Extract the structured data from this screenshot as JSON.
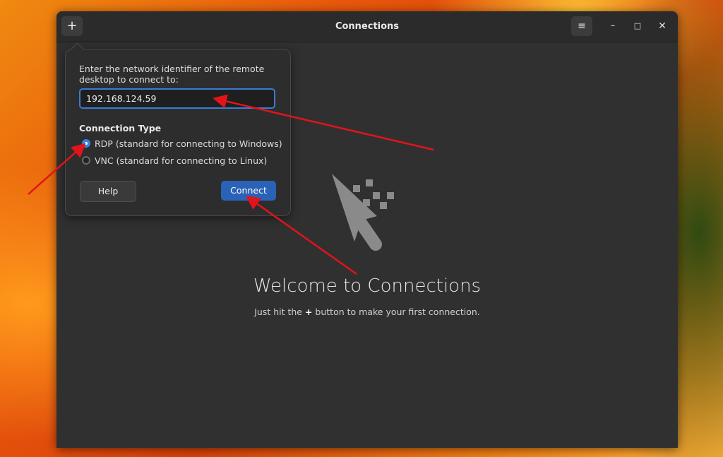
{
  "window": {
    "title": "Connections",
    "add_icon": "+",
    "menu_icon": "≡",
    "minimize_icon": "–",
    "maximize_icon": "□",
    "close_icon": "✕"
  },
  "popover": {
    "prompt": "Enter the network identifier of the remote desktop to connect to:",
    "address_value": "192.168.124.59",
    "connection_type_label": "Connection Type",
    "options": [
      {
        "label": "RDP (standard for connecting to Windows)",
        "selected": true
      },
      {
        "label": "VNC (standard for connecting to Linux)",
        "selected": false
      }
    ],
    "help_label": "Help",
    "connect_label": "Connect"
  },
  "welcome": {
    "title": "Welcome to Connections",
    "subtitle_before": "Just hit the ",
    "subtitle_plus": "+",
    "subtitle_after": " button to make your first connection."
  },
  "colors": {
    "accent": "#3584e4",
    "connect_button": "#2a62b8",
    "annotation_arrow": "#e0141a",
    "window_bg": "#303030"
  }
}
